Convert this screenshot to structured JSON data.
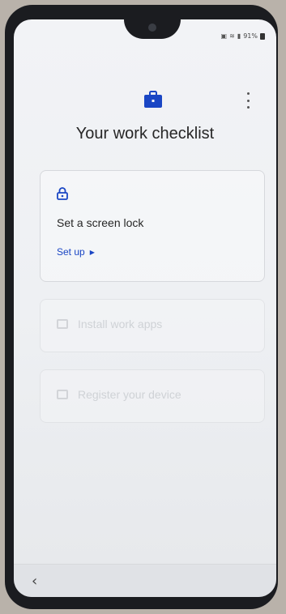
{
  "status_bar": {
    "battery_text": "91%",
    "icons": [
      "screenshot-icon",
      "wifi-icon",
      "signal-icon",
      "battery-icon"
    ]
  },
  "header": {
    "title": "Your work checklist",
    "icon": "briefcase-icon",
    "menu_icon": "more-vert-icon"
  },
  "cards": [
    {
      "icon": "lock-icon",
      "title": "Set a screen lock",
      "action_label": "Set up"
    },
    {
      "icon": "apps-icon",
      "title": "Install work apps"
    },
    {
      "icon": "register-icon",
      "title": "Register your device"
    }
  ],
  "nav": {
    "back_icon": "back-icon"
  },
  "colors": {
    "accent": "#1a46c4",
    "text": "#262626",
    "card_border": "#d6d8dc"
  }
}
